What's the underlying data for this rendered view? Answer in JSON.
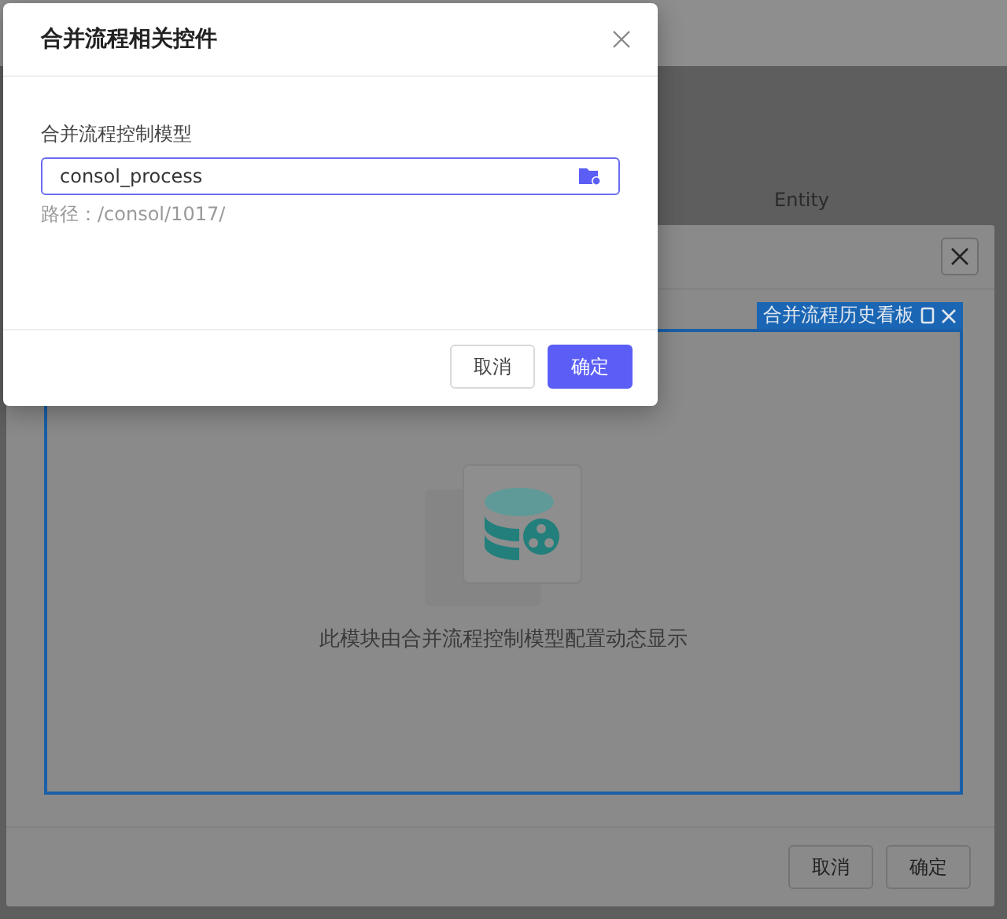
{
  "background": {
    "column_label": "Entity",
    "dialog": {
      "panel_tab": "合并流程历史看板",
      "empty_message": "此模块由合并流程控制模型配置动态显示",
      "buttons": [
        {
          "label": "取消"
        },
        {
          "label": "确定"
        }
      ]
    }
  },
  "modal": {
    "title": "合并流程相关控件",
    "field_label": "合并流程控制模型",
    "field_value": "consol_process",
    "path": "路径：/consol/1017/",
    "buttons": [
      {
        "label": "取消",
        "kind": "secondary"
      },
      {
        "label": "确定",
        "kind": "primary"
      }
    ]
  }
}
